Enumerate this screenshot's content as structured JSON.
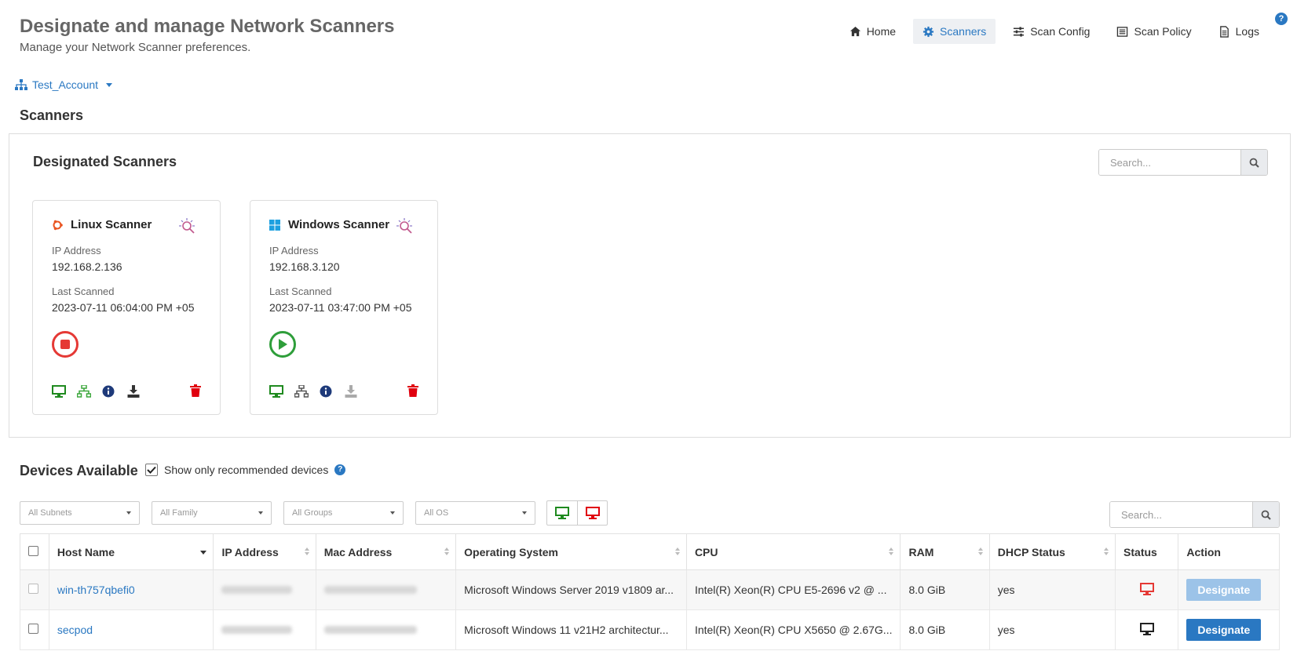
{
  "header": {
    "title": "Designate and manage Network Scanners",
    "subtitle": "Manage your Network Scanner preferences."
  },
  "nav": {
    "items": [
      {
        "label": "Home",
        "icon": "home-icon"
      },
      {
        "label": "Scanners",
        "icon": "gear-icon",
        "active": true
      },
      {
        "label": "Scan Config",
        "icon": "sliders-icon"
      },
      {
        "label": "Scan Policy",
        "icon": "list-icon"
      },
      {
        "label": "Logs",
        "icon": "file-icon"
      }
    ]
  },
  "account": {
    "name": "Test_Account"
  },
  "scanners_section": {
    "title": "Scanners",
    "panel_title": "Designated Scanners",
    "search_placeholder": "Search...",
    "cards": [
      {
        "name": "Linux Scanner",
        "os_icon": "ubuntu-icon",
        "ip_label": "IP Address",
        "ip": "192.168.2.136",
        "last_label": "Last Scanned",
        "last": "2023-07-11 06:04:00 PM +05",
        "action": "stop",
        "action_color": "#e53935"
      },
      {
        "name": "Windows Scanner",
        "os_icon": "windows-icon",
        "ip_label": "IP Address",
        "ip": "192.168.3.120",
        "last_label": "Last Scanned",
        "last": "2023-07-11 03:47:00 PM +05",
        "action": "play",
        "action_color": "#2e9e3a"
      }
    ]
  },
  "devices": {
    "title": "Devices Available",
    "recommend_label": "Show only recommended devices",
    "recommend_checked": true,
    "filters": [
      "All Subnets",
      "All Family",
      "All Groups",
      "All OS"
    ],
    "search_placeholder": "Search...",
    "columns": [
      "Host Name",
      "IP Address",
      "Mac Address",
      "Operating System",
      "CPU",
      "RAM",
      "DHCP Status",
      "Status",
      "Action"
    ],
    "rows": [
      {
        "host": "win-th757qbefi0",
        "os": "Microsoft Windows Server 2019 v1809 ar...",
        "cpu": "Intel(R) Xeon(R) CPU E5-2696 v2 @ ...",
        "ram": "8.0 GiB",
        "dhcp": "yes",
        "status_color": "#e53935",
        "action": "Designate",
        "action_enabled": false
      },
      {
        "host": "secpod",
        "os": "Microsoft Windows 11 v21H2 architectur...",
        "cpu": "Intel(R) Xeon(R) CPU X5650 @ 2.67G...",
        "ram": "8.0 GiB",
        "dhcp": "yes",
        "status_color": "#222222",
        "action": "Designate",
        "action_enabled": true
      }
    ]
  },
  "colors": {
    "accent": "#2a78c2",
    "danger": "#e53935",
    "success": "#2e9e3a"
  }
}
